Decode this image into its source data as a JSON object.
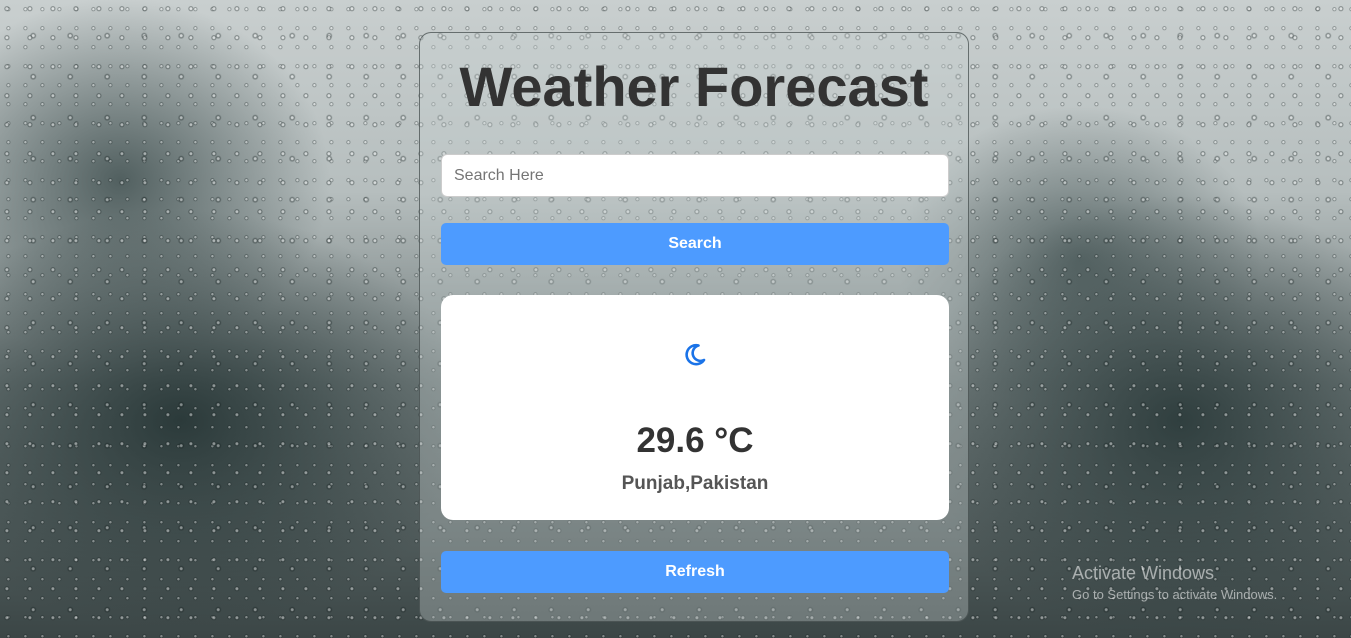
{
  "app": {
    "title": "Weather Forecast"
  },
  "search": {
    "placeholder": "Search Here",
    "value": "",
    "button_label": "Search"
  },
  "weather": {
    "icon": "crescent-moon-icon",
    "temperature": "29.6 °C",
    "location": "Punjab,Pakistan"
  },
  "refresh": {
    "button_label": "Refresh"
  },
  "watermark": {
    "title": "Activate Windows",
    "subtitle": "Go to Settings to activate Windows."
  },
  "colors": {
    "accent": "#4d9bff",
    "icon": "#1a73e8",
    "title_text": "#333333"
  }
}
